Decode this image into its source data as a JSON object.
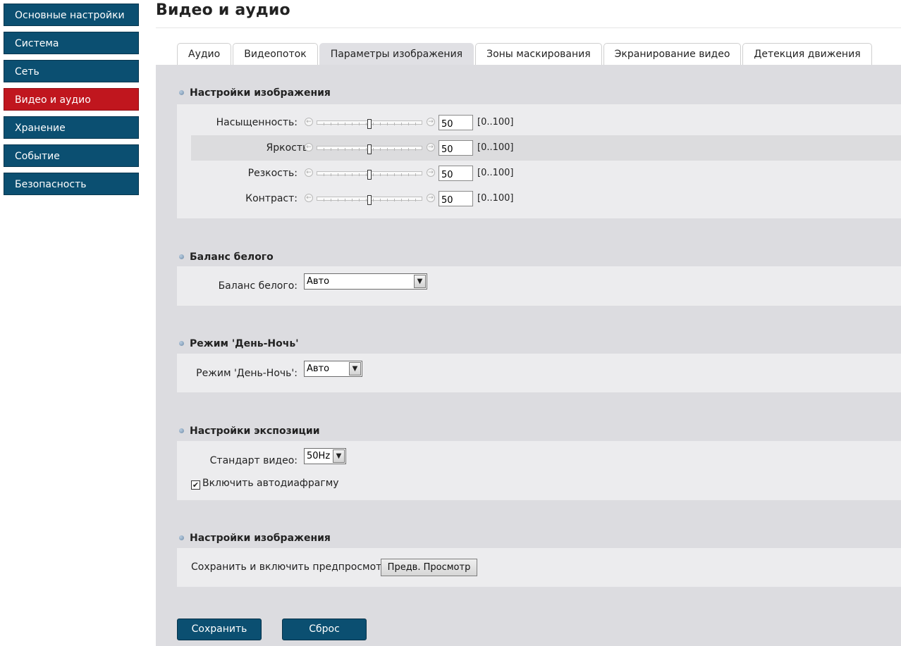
{
  "sidebar": {
    "items": [
      {
        "label": "Основные настройки",
        "active": false
      },
      {
        "label": "Система",
        "active": false
      },
      {
        "label": "Сеть",
        "active": false
      },
      {
        "label": "Видео и аудио",
        "active": true
      },
      {
        "label": "Хранение",
        "active": false
      },
      {
        "label": "Событие",
        "active": false
      },
      {
        "label": "Безопасность",
        "active": false
      }
    ]
  },
  "page": {
    "title": "Видео и аудио"
  },
  "tabs": [
    {
      "label": "Аудио"
    },
    {
      "label": "Видеопоток"
    },
    {
      "label": "Параметры изображения",
      "active": true
    },
    {
      "label": "Зоны маскирования"
    },
    {
      "label": "Экранирование видео"
    },
    {
      "label": "Детекция движения"
    }
  ],
  "image_settings": {
    "heading": "Настройки изображения",
    "range_text": "[0..100]",
    "sliders": [
      {
        "label": "Насыщенность:",
        "value": "50"
      },
      {
        "label": "Яркость:",
        "value": "50"
      },
      {
        "label": "Резкость:",
        "value": "50"
      },
      {
        "label": "Контраст:",
        "value": "50"
      }
    ]
  },
  "white_balance": {
    "heading": "Баланс белого",
    "label": "Баланс белого:",
    "selected": "Авто"
  },
  "day_night": {
    "heading": "Режим 'День-Ночь'",
    "label": "Режим 'День-Ночь':",
    "selected": "Авто"
  },
  "exposure": {
    "heading": "Настройки экспозиции",
    "video_standard_label": "Стандарт видео:",
    "video_standard_selected": "50Hz",
    "auto_iris_label": "Включить автодиафрагму",
    "auto_iris_checked": true
  },
  "preview": {
    "heading": "Настройки изображения",
    "text": "Сохранить и включить предпросмотр",
    "button_label": "Предв. Просмотр"
  },
  "actions": {
    "save_label": "Сохранить",
    "reset_label": "Сброс"
  },
  "colors": {
    "sidebar_bg": "#0b4f71",
    "sidebar_active_bg": "#c0161e",
    "content_bg": "#dcdce0",
    "panel_bg": "#ececee"
  }
}
